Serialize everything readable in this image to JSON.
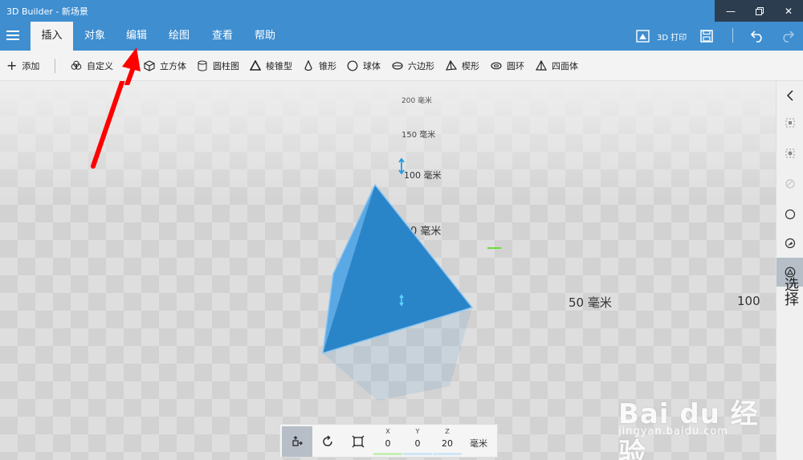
{
  "window": {
    "title": "3D Builder - 新场景",
    "controls": [
      "minimize",
      "restore",
      "close"
    ]
  },
  "tabs": [
    {
      "label": "插入",
      "active": true
    },
    {
      "label": "对象",
      "active": false
    },
    {
      "label": "编辑",
      "active": false
    },
    {
      "label": "绘图",
      "active": false
    },
    {
      "label": "查看",
      "active": false
    },
    {
      "label": "帮助",
      "active": false
    }
  ],
  "header_actions": {
    "print_label": "3D 打印",
    "print_icon": "print-3d-icon",
    "save_icon": "save-icon",
    "undo_icon": "undo-icon",
    "redo_icon": "redo-icon"
  },
  "toolbar": {
    "add_label": "添加",
    "items": [
      {
        "label": "自定义",
        "icon": "custom-shape-icon"
      },
      {
        "label": "立方体",
        "icon": "cube-icon"
      },
      {
        "label": "圆柱图",
        "icon": "cylinder-icon"
      },
      {
        "label": "棱锥型",
        "icon": "pyramid-icon"
      },
      {
        "label": "锥形",
        "icon": "cone-icon"
      },
      {
        "label": "球体",
        "icon": "sphere-icon"
      },
      {
        "label": "六边形",
        "icon": "hexagon-icon"
      },
      {
        "label": "楔形",
        "icon": "wedge-icon"
      },
      {
        "label": "圆环",
        "icon": "torus-icon"
      },
      {
        "label": "四面体",
        "icon": "tetrahedron-icon"
      }
    ]
  },
  "scene": {
    "ruler_labels": [
      "200 毫米",
      "150 毫米",
      "100 毫米",
      "0 毫米",
      "50 毫米",
      "100"
    ],
    "object": "tetrahedron",
    "object_color": "#2a85c8"
  },
  "right_panel": {
    "vertical_label": "选择",
    "icons": [
      "collapse-icon",
      "select-object-icon",
      "select-group-icon",
      "select-face-icon",
      "select-circle-icon",
      "select-paint-icon",
      "select-triangle-icon"
    ]
  },
  "position": {
    "labels": {
      "x": "X",
      "y": "Y",
      "z": "Z"
    },
    "values": {
      "x": "0",
      "y": "0",
      "z": "20"
    },
    "unit": "毫米"
  },
  "watermark": {
    "main": "Bai du 经验",
    "sub": "jingyan.baidu.com"
  },
  "colors": {
    "accent": "#3e8ed0",
    "object": "#2a85c8",
    "arrow": "#ff0000"
  }
}
